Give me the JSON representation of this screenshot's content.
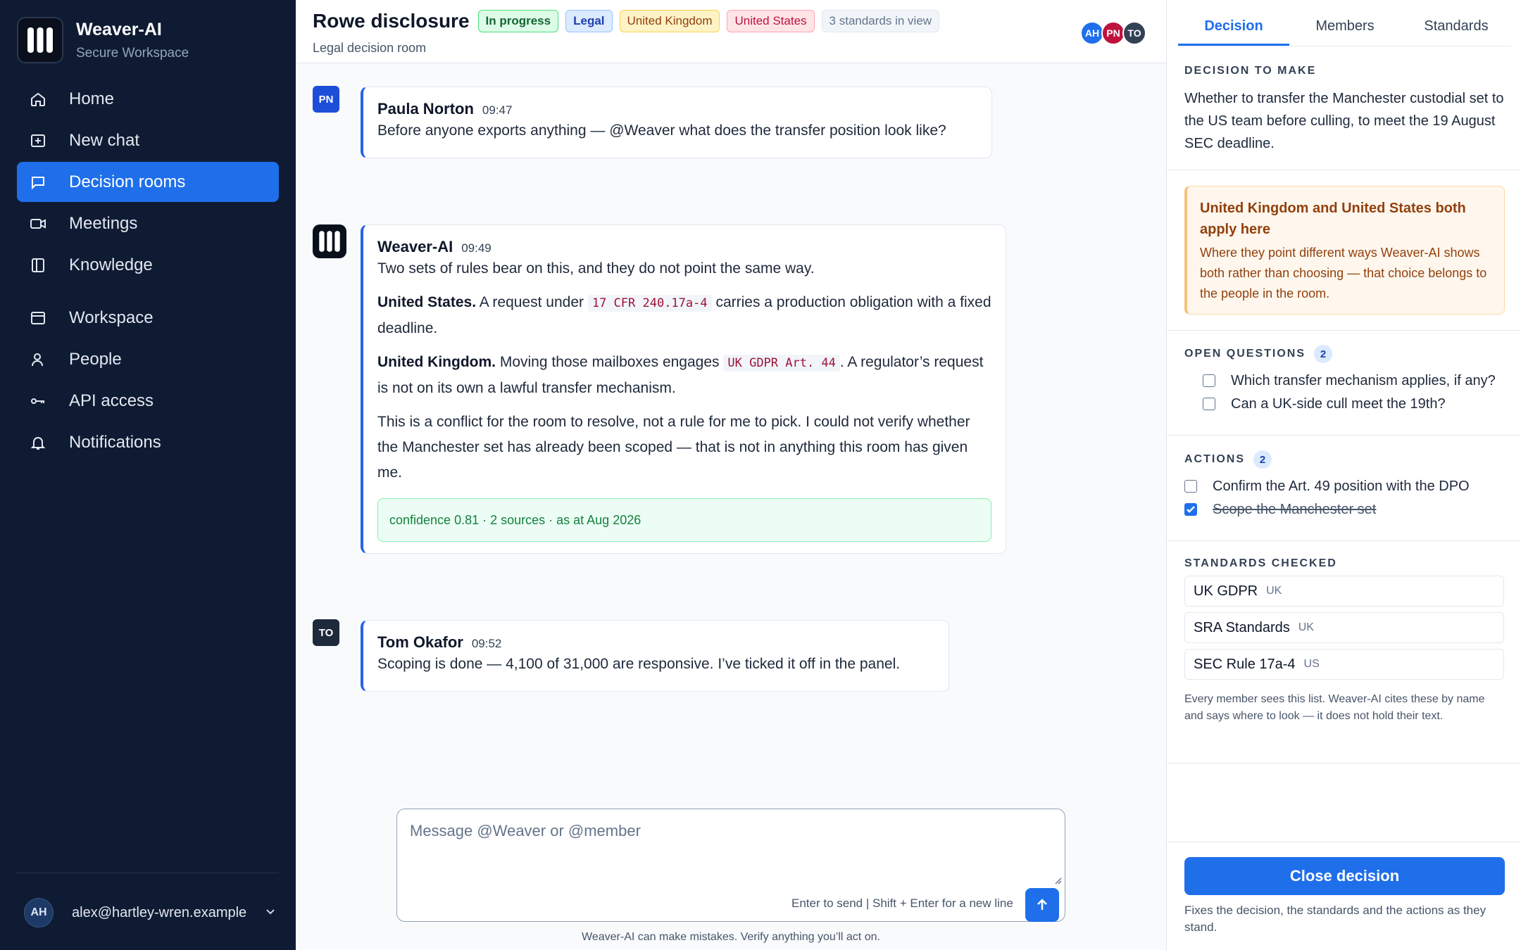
{
  "app": {
    "name": "Weaver-AI",
    "subtitle": "Secure Workspace"
  },
  "sidebar": {
    "items": [
      {
        "label": "Home",
        "icon": "home-icon"
      },
      {
        "label": "New chat",
        "icon": "plus-square-icon"
      },
      {
        "label": "Decision rooms",
        "icon": "chat-icon",
        "active": true
      },
      {
        "label": "Meetings",
        "icon": "video-icon"
      },
      {
        "label": "Knowledge",
        "icon": "book-icon"
      },
      {
        "label": "Workspace",
        "icon": "window-icon"
      },
      {
        "label": "People",
        "icon": "person-icon"
      },
      {
        "label": "API access",
        "icon": "key-icon"
      },
      {
        "label": "Notifications",
        "icon": "bell-icon"
      }
    ],
    "user": {
      "initials": "AH",
      "email": "alex@hartley-wren.example"
    }
  },
  "header": {
    "title": "Rowe disclosure",
    "subtitle": "Legal decision room",
    "chips": [
      "In progress",
      "Legal",
      "United Kingdom",
      "United States",
      "3 standards in view"
    ],
    "avatars": [
      "AH",
      "PN",
      "TO"
    ]
  },
  "messages": [
    {
      "initials": "PN",
      "author": "Paula Norton",
      "time": "09:47",
      "text": "Before anyone exports anything — @Weaver what does the transfer position look like?"
    },
    {
      "author": "Weaver-AI",
      "time": "09:49",
      "intro": "Two sets of rules bear on this, and they do not point the same way.",
      "us_heading": "United States.",
      "us_pre": "A request under",
      "us_code": "17 CFR 240.17a-4",
      "us_post": "carries a production obligation with a fixed deadline.",
      "uk_heading": "United Kingdom.",
      "uk_pre": "Moving those mailboxes engages",
      "uk_code": "UK GDPR Art. 44",
      "uk_post": ". A regulator’s request is not on its own a lawful transfer mechanism.",
      "closing": "This is a conflict for the room to resolve, not a rule for me to pick. I could not verify whether the Manchester set has already been scoped — that is not in anything this room has given me.",
      "confidence": "confidence 0.81 · 2 sources · as at Aug 2026"
    },
    {
      "initials": "TO",
      "author": "Tom Okafor",
      "time": "09:52",
      "text": "Scoping is done — 4,100 of 31,000 are responsive. I’ve ticked it off in the panel."
    }
  ],
  "composer": {
    "placeholder": "Message @Weaver or @member",
    "hint": "Enter to send | Shift + Enter for a new line",
    "disclaimer": "Weaver-AI can make mistakes. Verify anything you’ll act on."
  },
  "panel": {
    "tabs": [
      "Decision",
      "Members",
      "Standards"
    ],
    "decision_label": "DECISION TO MAKE",
    "decision_text": "Whether to transfer the Manchester custodial set to the US team before culling, to meet the 19 August SEC deadline.",
    "warning_title": "United Kingdom and United States both apply here",
    "warning_body": "Where they point different ways Weaver-AI shows both rather than choosing — that choice belongs to the people in the room.",
    "questions_label": "OPEN QUESTIONS",
    "questions_count": "2",
    "questions": [
      "Which transfer mechanism applies, if any?",
      "Can a UK-side cull meet the 19th?"
    ],
    "actions_label": "ACTIONS",
    "actions_count": "2",
    "actions": [
      {
        "label": "Confirm the Art. 49 position with the DPO",
        "done": false
      },
      {
        "label": "Scope the Manchester set",
        "done": true
      }
    ],
    "standards_label": "STANDARDS CHECKED",
    "standards": [
      {
        "name": "UK GDPR",
        "jurisdiction": "UK"
      },
      {
        "name": "SRA Standards",
        "jurisdiction": "UK"
      },
      {
        "name": "SEC Rule 17a-4",
        "jurisdiction": "US"
      }
    ],
    "standards_note": "Every member sees this list. Weaver-AI cites these by name and says where to look — it does not hold their text.",
    "close_button": "Close decision",
    "close_note": "Fixes the decision, the standards and the actions as they stand."
  },
  "colors": {
    "accent": "#1f6feb",
    "sidebar_bg": "#0f1b33",
    "warning_bg": "#fff7ed"
  }
}
